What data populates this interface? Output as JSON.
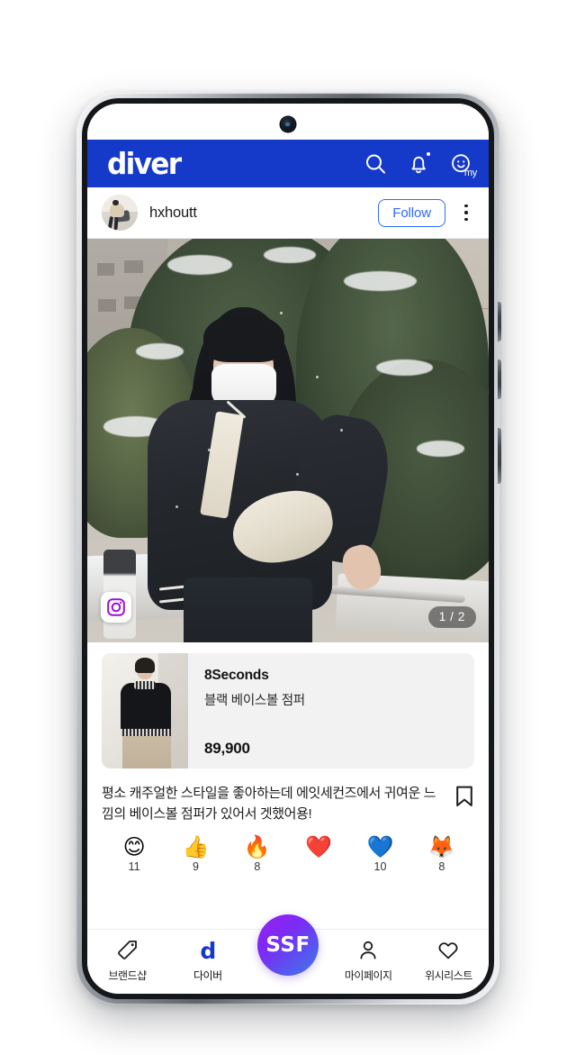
{
  "app": {
    "brand_logo": "diver",
    "header_icons": {
      "search": "search-icon",
      "notification": "bell-icon",
      "my": "my"
    }
  },
  "post": {
    "username": "hxhoutt",
    "follow_label": "Follow",
    "menu": "more-options",
    "media": {
      "page_indicator": "1 / 2",
      "source_badge": "instagram-icon"
    },
    "product": {
      "brand": "8Seconds",
      "name": "블랙 베이스볼 점퍼",
      "price": "89,900"
    },
    "caption": "평소 캐주얼한 스타일을 좋아하는데 에잇세컨즈에서 귀여운 느낌의 베이스볼 점퍼가 있어서 겟했어용!",
    "bookmark": "bookmark-icon",
    "reactions": [
      {
        "emoji": "😊",
        "name": "smiling-face-reaction",
        "count": "11"
      },
      {
        "emoji": "👍",
        "name": "thumbs-up-reaction",
        "count": "9"
      },
      {
        "emoji": "🔥",
        "name": "fire-reaction",
        "count": "8"
      },
      {
        "emoji": "❤️",
        "name": "red-heart-reaction",
        "count": ""
      },
      {
        "emoji": "💙",
        "name": "blue-heart-reaction",
        "count": "10"
      },
      {
        "emoji": "🦊",
        "name": "fox-reaction",
        "count": "8"
      }
    ]
  },
  "bottom_nav": {
    "items": [
      {
        "label": "브랜드샵",
        "icon": "tag-icon"
      },
      {
        "label": "다이버",
        "icon": "diver-d-icon"
      },
      {
        "label": "마이페이지",
        "icon": "person-icon"
      },
      {
        "label": "위시리스트",
        "icon": "heart-outline-icon"
      }
    ],
    "center_button": "SSF"
  },
  "colors": {
    "header_blue": "#1539c9",
    "follow_blue": "#2f6bff",
    "ssf_gradient_start": "#9b20f0",
    "ssf_gradient_end": "#3f7ae8",
    "card_bg": "#f2f2f3"
  }
}
